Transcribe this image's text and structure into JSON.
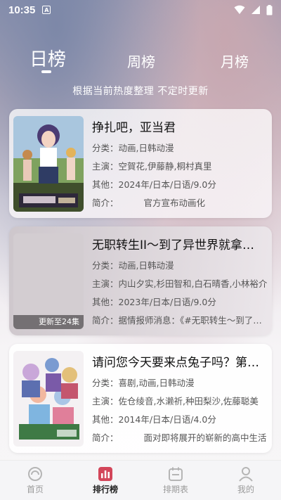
{
  "status_bar": {
    "time": "10:35",
    "notification_glyph": "A"
  },
  "tabs": [
    {
      "label": "日榜",
      "active": true
    },
    {
      "label": "周榜",
      "active": false
    },
    {
      "label": "月榜",
      "active": false
    }
  ],
  "subtitle": "根据当前热度整理 不定时更新",
  "cards": [
    {
      "title": "挣扎吧，亚当君",
      "category_label": "分类：",
      "category": "动画,日韩动漫",
      "cast_label": "主演：",
      "cast": "空賀花,伊藤静,桐村真里",
      "other_label": "其他：",
      "other": "2024年/日本/日语/9.0分",
      "intro_label": "简介：",
      "intro": "官方宣布动画化",
      "badge": ""
    },
    {
      "title": "无职转生II～到了异世界就拿出真本事～",
      "category_label": "分类：",
      "category": "动画,日韩动漫",
      "cast_label": "主演：",
      "cast": "内山夕实,杉田智和,白石晴香,小林裕介",
      "other_label": "其他：",
      "other": "2023年/日本/日语/9.0分",
      "intro_label": "简介：",
      "intro": "据情报师消息：《#无职转生～到了异世界就拿出真本事～》",
      "badge": "更新至24集"
    },
    {
      "title": "请问您今天要来点兔子吗？第三季",
      "category_label": "分类：",
      "category": "喜剧,动画,日韩动漫",
      "cast_label": "主演：",
      "cast": "佐仓绫音,水濑祈,种田梨沙,佐藤聪美",
      "other_label": "其他：",
      "other": "2014年/日本/日语/4.0分",
      "intro_label": "简介：",
      "intro": "面对即将展开的崭新的高中生活",
      "badge": ""
    }
  ],
  "bottom_nav": [
    {
      "label": "首页",
      "icon": "home-icon",
      "active": false
    },
    {
      "label": "排行榜",
      "icon": "ranking-icon",
      "active": true
    },
    {
      "label": "排期表",
      "icon": "calendar-icon",
      "active": false
    },
    {
      "label": "我的",
      "icon": "profile-icon",
      "active": false
    }
  ],
  "colors": {
    "accent": "#d3465a",
    "inactive": "#9a9a9a"
  }
}
